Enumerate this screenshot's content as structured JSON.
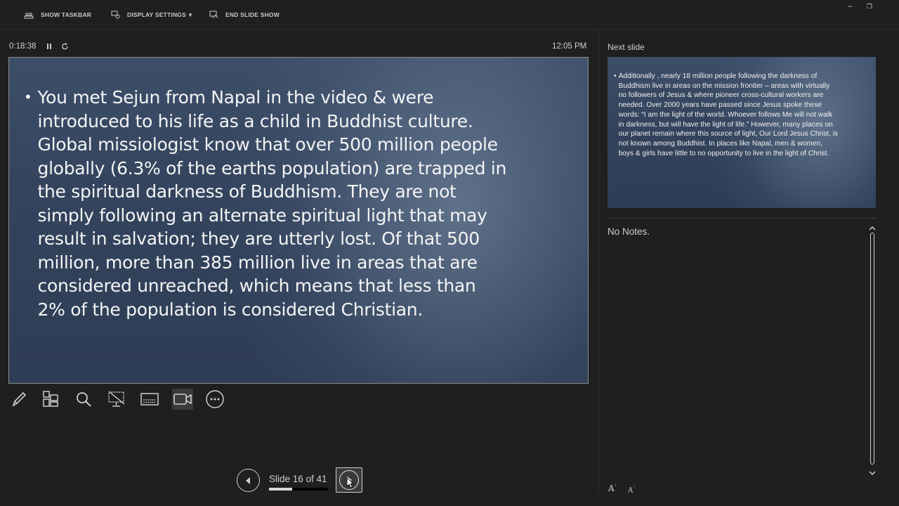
{
  "topbar": {
    "show_taskbar": "SHOW TASKBAR",
    "display_settings": "DISPLAY SETTINGS",
    "end_slide_show": "END SLIDE SHOW",
    "minimize_glyph": "–",
    "restore_glyph": "❐"
  },
  "timer": {
    "elapsed": "0:18:38",
    "clock": "12:05 PM"
  },
  "current_slide": {
    "bullet": "•",
    "text": "You met Sejun from Napal in the video & were introduced to his life as a child in Buddhist culture. Global missiologist know that over 500 million people globally (6.3% of the earths population) are trapped in the spiritual darkness of Buddhism. They are not simply following an alternate spiritual light that may result in salvation; they are utterly lost. Of that 500 million, more than 385 million live in areas that are considered unreached, which means that less than 2% of the population is considered Christian."
  },
  "tools": [
    "pen-icon",
    "see-all-slides-icon",
    "zoom-icon",
    "black-screen-icon",
    "subtitles-icon",
    "camera-icon",
    "more-options-icon"
  ],
  "navigation": {
    "slide_counter": "Slide 16 of 41",
    "current": 16,
    "total": 41
  },
  "next_slide": {
    "label": "Next slide",
    "bullet": "•",
    "text": "Additionally , nearly 18 million people following the darkness of Buddhism live in areas on the mission frontier – areas with virtually no followers of Jesus & where pioneer cross-cultural workers are needed. Over 2000 years have passed since Jesus spoke these words: “I am the light of the world. Whoever follows Me will not walk in darkness, but will have the light of life.”  However, many places on our planet remain where this source of light, Our Lord Jesus Christ, is not known among Buddhist. In places like Napal, men & women, boys & girls have little to no opportunity to live in the light of Christ."
  },
  "notes": {
    "text": "No Notes."
  },
  "font_controls": {
    "increase": "A",
    "decrease": "A"
  }
}
